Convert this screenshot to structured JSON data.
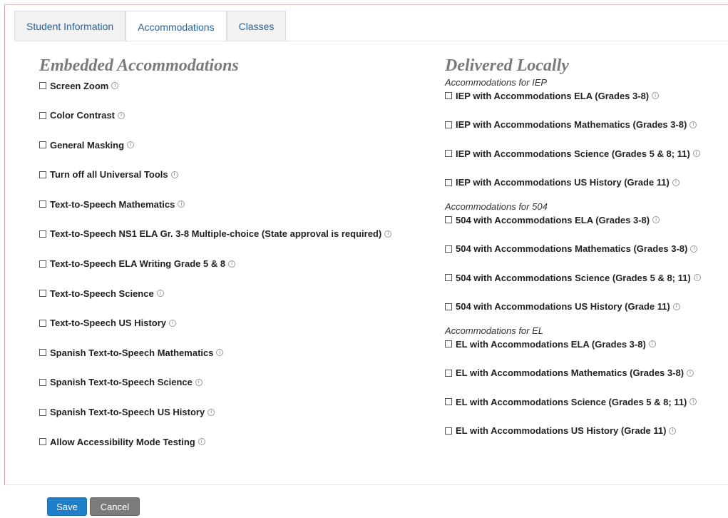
{
  "tabs": [
    {
      "label": "Student Information",
      "active": false
    },
    {
      "label": "Accommodations",
      "active": true
    },
    {
      "label": "Classes",
      "active": false
    }
  ],
  "embedded": {
    "title": "Embedded Accommodations",
    "options": [
      "Screen Zoom",
      "Color Contrast",
      "General Masking",
      "Turn off all Universal Tools",
      "Text-to-Speech Mathematics",
      "Text-to-Speech NS1 ELA Gr. 3-8 Multiple-choice (State approval is required)",
      "Text-to-Speech ELA Writing Grade 5 & 8",
      "Text-to-Speech Science",
      "Text-to-Speech US History",
      "Spanish Text-to-Speech Mathematics",
      "Spanish Text-to-Speech Science",
      "Spanish Text-to-Speech US History",
      "Allow Accessibility Mode Testing"
    ]
  },
  "local": {
    "title": "Delivered Locally",
    "groups": [
      {
        "label": "Accommodations for IEP",
        "options": [
          "IEP with Accommodations ELA (Grades 3-8)",
          "IEP with Accommodations Mathematics (Grades 3-8)",
          "IEP with Accommodations Science (Grades 5 & 8; 11)",
          "IEP with Accommodations US History (Grade 11)"
        ]
      },
      {
        "label": "Accommodations for 504",
        "options": [
          "504 with Accommodations ELA (Grades 3-8)",
          "504 with Accommodations Mathematics (Grades 3-8)",
          "504 with Accommodations Science (Grades 5 & 8; 11)",
          "504 with Accommodations US History (Grade 11)"
        ]
      },
      {
        "label": "Accommodations for EL",
        "options": [
          "EL with Accommodations ELA (Grades 3-8)",
          "EL with Accommodations Mathematics (Grades 3-8)",
          "EL with Accommodations Science (Grades 5 & 8; 11)",
          "EL with Accommodations US History (Grade 11)"
        ]
      }
    ]
  },
  "buttons": {
    "save": "Save",
    "cancel": "Cancel"
  },
  "colors": {
    "accent": "#1e7ec7",
    "tab_text": "#2a6496",
    "cancel": "#7b7b7b"
  }
}
